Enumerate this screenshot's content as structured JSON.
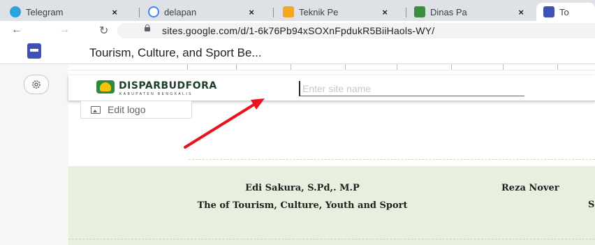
{
  "browser": {
    "tabs": [
      {
        "title": "Telegram",
        "favicon_color": "#2aa3df",
        "favicon": "telegram-favicon"
      },
      {
        "title": "delapan",
        "favicon_color": "#4285f4",
        "favicon": "google-favicon"
      },
      {
        "title": "Teknik Pe",
        "favicon_color": "#f5a623",
        "favicon": "blogger-favicon"
      },
      {
        "title": "Dinas Pa",
        "favicon_color": "#3c8d3f",
        "favicon": "dinas-favicon"
      },
      {
        "title": "To",
        "favicon_color": "#3f51b5",
        "favicon": "sites-favicon"
      }
    ],
    "close_glyph": "×",
    "url": "sites.google.com/d/1-6k76Pb94xSOXnFpdukR5BiiHaols-WY/"
  },
  "app": {
    "document_title": "Tourism, Culture, and Sport Be..."
  },
  "header": {
    "logo_text": "DISPARBUDFORA",
    "logo_subtext": "KABUPATEN BENGKALIS",
    "site_name_placeholder": "Enter site name",
    "edit_logo_label": "Edit logo"
  },
  "content": {
    "person1": {
      "name": "Edi Sakura, S.Pd,. M.P",
      "role": "The of Tourism, Culture, Youth and Sport"
    },
    "person2": {
      "name": "Reza Nover",
      "role": "S"
    }
  },
  "colors": {
    "annotation_arrow": "#e8141c",
    "content_band": "#e9efdf",
    "sites_brand": "#3f51b5"
  }
}
